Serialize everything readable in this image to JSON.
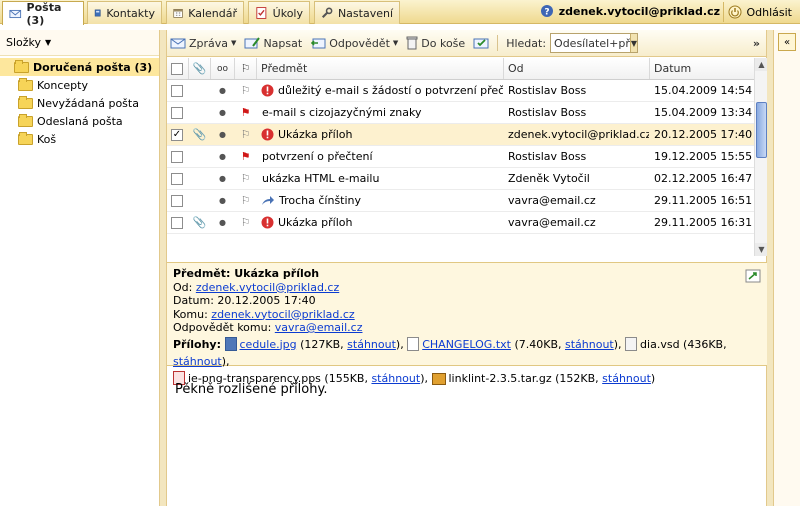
{
  "tabs": [
    {
      "label": "Pošta (3)",
      "icon": "mail-icon",
      "active": true
    },
    {
      "label": "Kontakty",
      "icon": "address-book-icon"
    },
    {
      "label": "Kalendář",
      "icon": "calendar-icon"
    },
    {
      "label": "Úkoly",
      "icon": "task-icon"
    },
    {
      "label": "Nastavení",
      "icon": "wrench-icon"
    }
  ],
  "user": {
    "email": "zdenek.vytocil@priklad.cz",
    "logout": "Odhlásit"
  },
  "sidebar": {
    "title": "Složky",
    "folders": [
      {
        "label": "Doručená pošta (3)",
        "selected": true
      },
      {
        "label": "Koncepty"
      },
      {
        "label": "Nevyžádaná pošta"
      },
      {
        "label": "Odeslaná pošta"
      },
      {
        "label": "Koš"
      }
    ]
  },
  "toolbar": {
    "message": "Zpráva",
    "compose": "Napsat",
    "reply": "Odpovědět",
    "move": "Do koše",
    "search_label": "Hledat:",
    "search_value": "Odesílatel+př"
  },
  "columns": {
    "subject": "Předmět",
    "from": "Od",
    "date": "Datum"
  },
  "messages": [
    {
      "subject": "důležitý e-mail s žádostí o potvrzení přečtení",
      "from": "Rostislav Boss",
      "date": "15.04.2009 14:54",
      "important": true,
      "flag": false,
      "attach": false,
      "checked": false
    },
    {
      "subject": "e-mail s cizojazyčnými znaky",
      "from": "Rostislav Boss",
      "date": "15.04.2009 13:34",
      "important": false,
      "flag": true,
      "attach": false,
      "checked": false
    },
    {
      "subject": "Ukázka příloh",
      "from": "zdenek.vytocil@priklad.cz",
      "date": "20.12.2005 17:40",
      "important": true,
      "flag": false,
      "attach": true,
      "checked": true,
      "selected": true
    },
    {
      "subject": "potvrzení o přečtení",
      "from": "Rostislav Boss",
      "date": "19.12.2005 15:55",
      "important": false,
      "flag": true,
      "attach": false,
      "checked": false
    },
    {
      "subject": "ukázka HTML e-mailu",
      "from": "Zdeněk Vytočil",
      "date": "02.12.2005 16:47",
      "important": false,
      "flag": false,
      "attach": false,
      "checked": false
    },
    {
      "subject": "Trocha čínštiny",
      "from": "vavra@email.cz",
      "date": "29.11.2005 16:51",
      "important": false,
      "flag": false,
      "attach": false,
      "checked": false,
      "forwarded": true
    },
    {
      "subject": "Ukázka příloh",
      "from": "vavra@email.cz",
      "date": "29.11.2005 16:31",
      "important": true,
      "flag": false,
      "attach": true,
      "checked": false
    }
  ],
  "preview": {
    "subject_label": "Předmět:",
    "subject": "Ukázka příloh",
    "from_label": "Od:",
    "from": "zdenek.vytocil@priklad.cz",
    "date_label": "Datum:",
    "date": "20.12.2005 17:40",
    "to_label": "Komu:",
    "to": "zdenek.vytocil@priklad.cz",
    "reply_label": "Odpovědět komu:",
    "reply_to": "vavra@email.cz",
    "att_label": "Přílohy:",
    "download": "stáhnout",
    "attachments": [
      {
        "name": "cedule.jpg",
        "size": "(127KB,",
        "icon": "image-file-icon"
      },
      {
        "name": "CHANGELOG.txt",
        "size": "(7.40KB,",
        "icon": "text-file-icon"
      },
      {
        "name": "dia.vsd",
        "size": "(436KB,",
        "icon": "file-icon"
      },
      {
        "name": "ie-png-transparency.pps",
        "size": "(155KB,",
        "icon": "presentation-file-icon"
      },
      {
        "name": "linklint-2.3.5.tar.gz",
        "size": "(152KB,",
        "icon": "archive-file-icon"
      }
    ],
    "body": "Pěkně rozlišené přílohy."
  }
}
